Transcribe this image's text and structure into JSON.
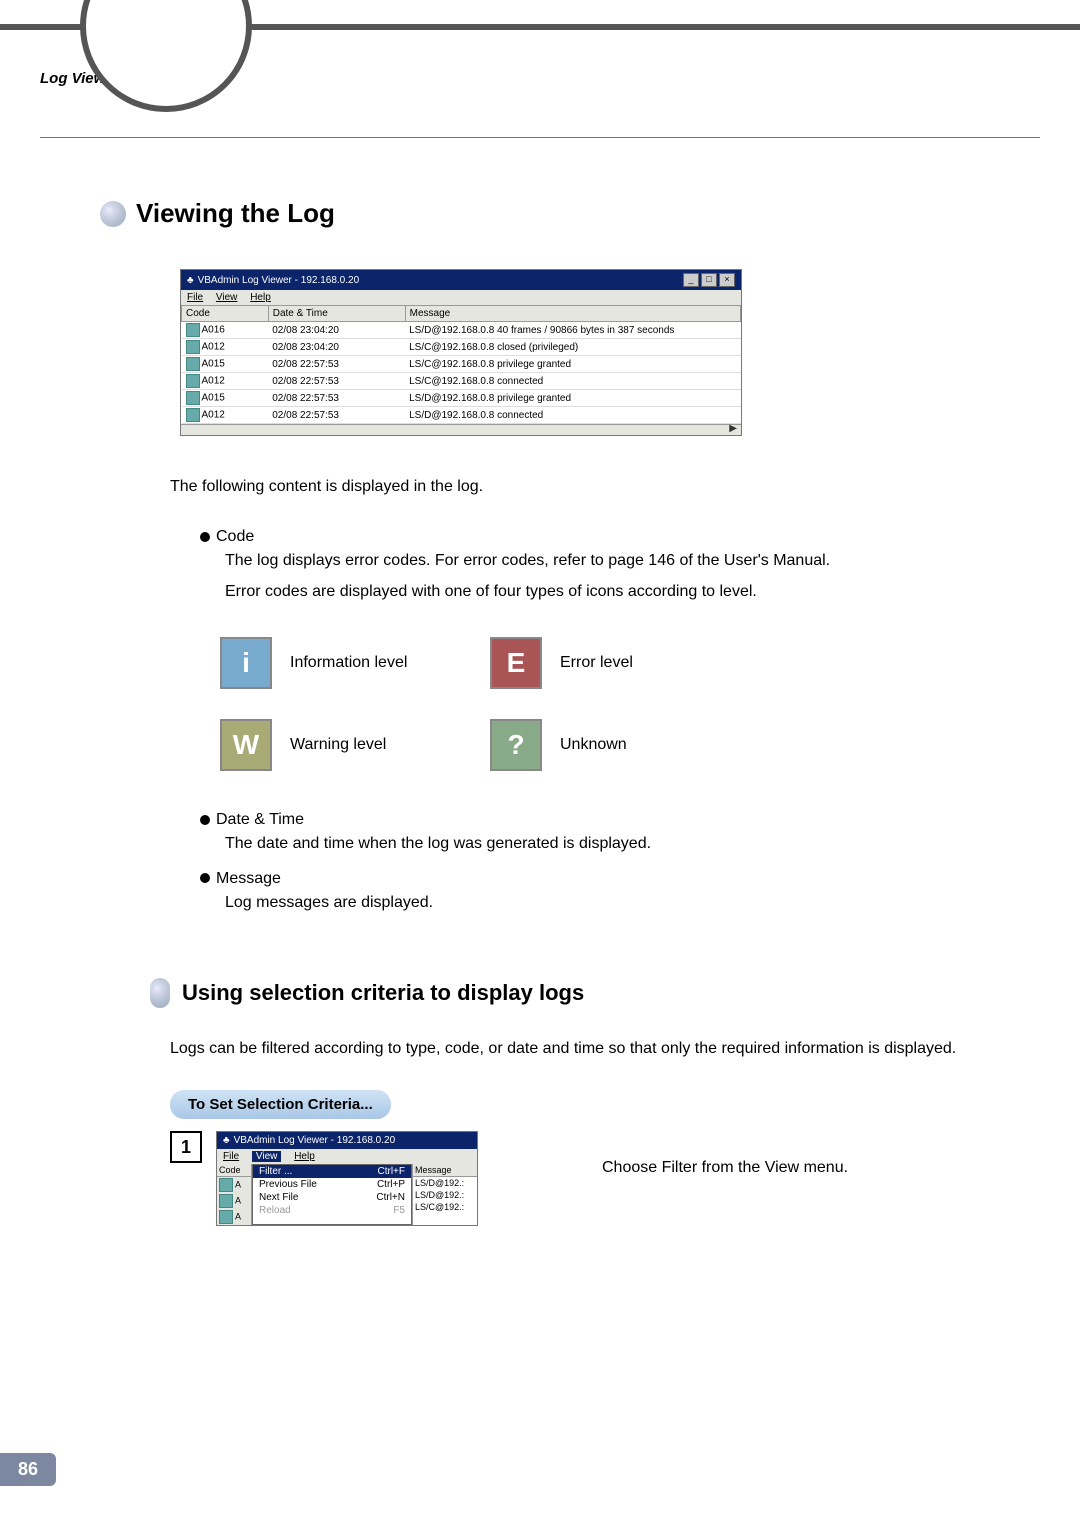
{
  "header": {
    "section": "Log Viewer"
  },
  "section1": {
    "title": "Viewing the Log",
    "window_title": "VBAdmin Log Viewer - 192.168.0.20",
    "menu": {
      "file": "File",
      "view": "View",
      "help": "Help"
    },
    "cols": {
      "code": "Code",
      "datetime": "Date & Time",
      "message": "Message"
    },
    "rows": [
      {
        "code": "A016",
        "dt": "02/08 23:04:20",
        "msg": "LS/D@192.168.0.8 40 frames / 90866 bytes in 387 seconds"
      },
      {
        "code": "A012",
        "dt": "02/08 23:04:20",
        "msg": "LS/C@192.168.0.8 closed (privileged)"
      },
      {
        "code": "A015",
        "dt": "02/08 22:57:53",
        "msg": "LS/C@192.168.0.8 privilege granted"
      },
      {
        "code": "A012",
        "dt": "02/08 22:57:53",
        "msg": "LS/C@192.168.0.8 connected"
      },
      {
        "code": "A015",
        "dt": "02/08 22:57:53",
        "msg": "LS/D@192.168.0.8 privilege granted"
      },
      {
        "code": "A012",
        "dt": "02/08 22:57:53",
        "msg": "LS/D@192.168.0.8 connected"
      }
    ],
    "intro": "The following content is displayed in the log.",
    "code_hdr": "Code",
    "code_desc1": "The log displays error codes. For error codes, refer to page 146 of the User's Manual.",
    "code_desc2": "Error codes are displayed with one of four types of icons according to level.",
    "levels": {
      "info": "Information level",
      "error": "Error level",
      "warn": "Warning level",
      "unknown": "Unknown"
    },
    "date_hdr": "Date & Time",
    "date_desc": "The date and time when the log was generated is displayed.",
    "msg_hdr": "Message",
    "msg_desc": "Log messages are displayed."
  },
  "section2": {
    "title": "Using selection criteria to display logs",
    "intro": "Logs can be filtered according to type, code, or date and time so that only the required information is displayed.",
    "pill": "To Set Selection Criteria...",
    "step1_num": "1",
    "window_title": "VBAdmin Log Viewer - 192.168.0.20",
    "menu": {
      "file": "File",
      "view": "View",
      "help": "Help"
    },
    "col_code": "Code",
    "col_msg": "Message",
    "menu_items": {
      "filter": "Filter ...",
      "filter_k": "Ctrl+F",
      "prev": "Previous File",
      "prev_k": "Ctrl+P",
      "next": "Next File",
      "next_k": "Ctrl+N",
      "reload": "Reload",
      "reload_k": "F5"
    },
    "side_msgs": [
      "LS/D@192.:",
      "LS/D@192.:",
      "LS/C@192.:"
    ],
    "side_codes": [
      "A",
      "A",
      "A"
    ],
    "instruction": "Choose Filter from the View menu."
  },
  "page_number": "86"
}
